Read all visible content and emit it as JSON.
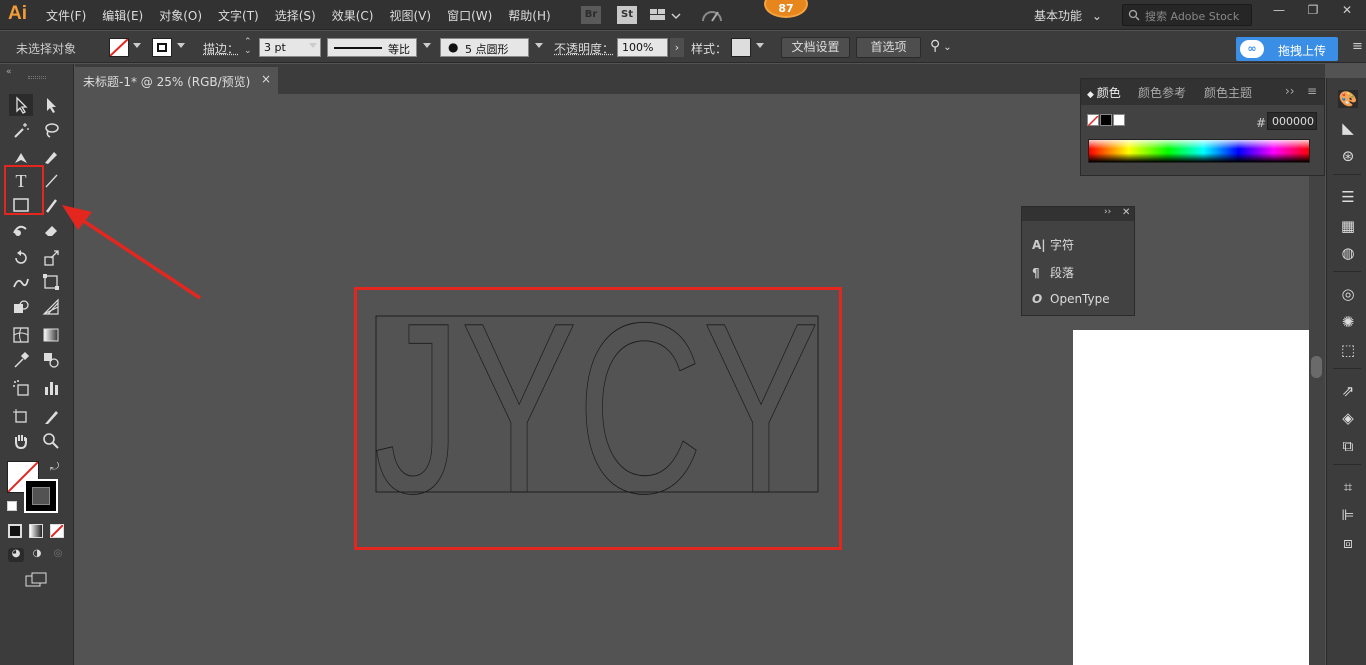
{
  "app": {
    "logo": "Ai"
  },
  "menu": [
    "文件(F)",
    "编辑(E)",
    "对象(O)",
    "文字(T)",
    "选择(S)",
    "效果(C)",
    "视图(V)",
    "窗口(W)",
    "帮助(H)"
  ],
  "bridge": "Br",
  "stock": "St",
  "badge": "87",
  "workspace": "基本功能",
  "search_placeholder": "搜索 Adobe Stock",
  "control": {
    "selection_state": "未选择对象",
    "stroke_label": "描边：",
    "stroke_weight": "3 pt",
    "stroke_profile": "等比",
    "brush": "5 点圆形",
    "opacity_label": "不透明度：",
    "opacity_value": "100%",
    "style_label": "样式：",
    "doc_setup": "文档设置",
    "prefs": "首选项",
    "upload": "拖拽上传",
    "upload_logo": "∞"
  },
  "document": {
    "tab": "未标题-1* @ 25% (RGB/预览)",
    "close": "×"
  },
  "artwork": {
    "text": "JYCY"
  },
  "color_panel": {
    "tabs": [
      "颜色",
      "颜色参考",
      "颜色主题"
    ],
    "hex_label": "#",
    "hex_value": "000000"
  },
  "char_panel": {
    "items": [
      {
        "icon": "A|",
        "label": "字符"
      },
      {
        "icon": "¶",
        "label": "段落"
      },
      {
        "icon": "O",
        "label": "OpenType"
      }
    ]
  },
  "colors": {
    "accent": "#f29d36",
    "highlight": "#e3271f",
    "upload": "#3a8ee6"
  }
}
